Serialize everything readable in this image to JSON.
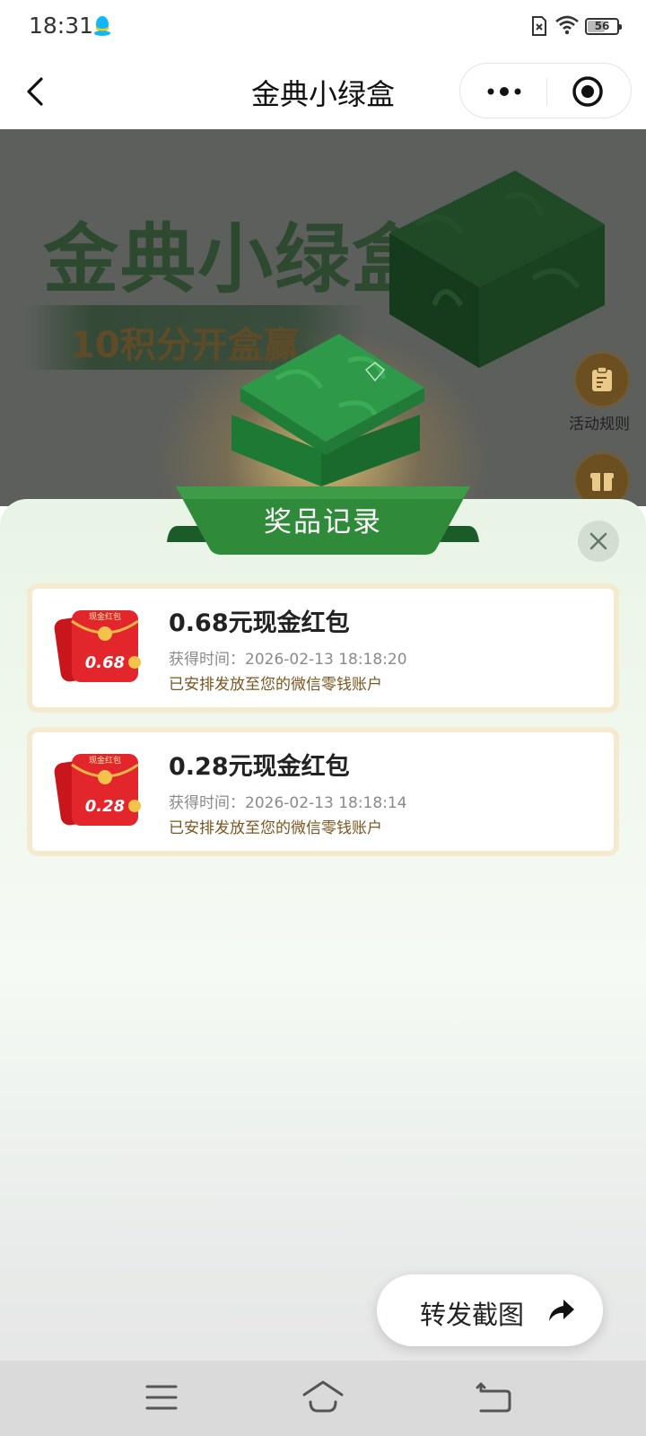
{
  "status_bar": {
    "time": "18:31",
    "battery": "56",
    "battery_level": 0.56,
    "icons": [
      "qq-icon",
      "sim-off-icon",
      "wifi-icon",
      "battery-icon"
    ]
  },
  "title_bar": {
    "title": "金典小绿盒",
    "icons": [
      "back-arrow-icon",
      "more-dots-icon",
      "target-icon"
    ]
  },
  "banner": {
    "title": "金典小绿盒",
    "subtitle": "10积分开盒赢",
    "rules_label": "活动规则",
    "icons": [
      "rules-icon",
      "gift-icon"
    ]
  },
  "sheet": {
    "title": "奖品记录",
    "records": [
      {
        "title": "0.68元现金红包",
        "envelope_label": "现金红包",
        "envelope_amount": "0.68",
        "time_label": "获得时间：",
        "time": "2026-02-13 18:18:20",
        "note": "已安排发放至您的微信零钱账户"
      },
      {
        "title": "0.28元现金红包",
        "envelope_label": "现金红包",
        "envelope_amount": "0.28",
        "time_label": "获得时间：",
        "time": "2026-02-13 18:18:14",
        "note": "已安排发放至您的微信零钱账户"
      }
    ],
    "share_label": "转发截图",
    "icons": [
      "close-icon",
      "share-arrow-icon"
    ]
  },
  "nav_bar": {
    "icons": [
      "menu-icon",
      "home-icon",
      "back-icon"
    ]
  },
  "colors": {
    "accent_green": "#2f8a3a",
    "card_border": "#f4ead0",
    "note_brown": "#7a5520",
    "envelope_red": "#e3262b"
  }
}
